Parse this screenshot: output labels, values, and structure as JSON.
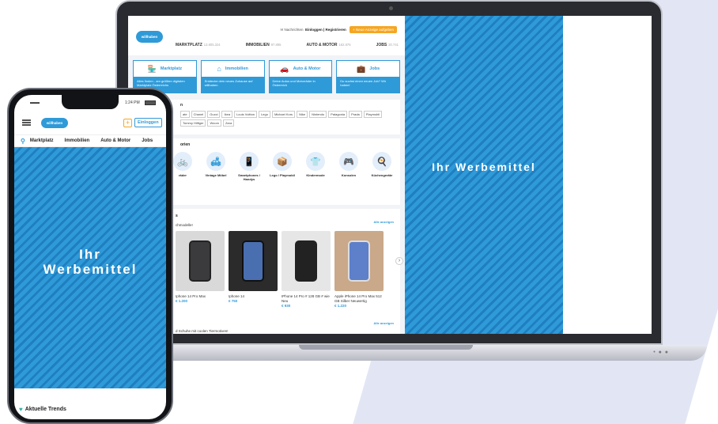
{
  "desktop": {
    "top_links": {
      "messages": "Nachrichten",
      "login": "Einloggen | Registrieren",
      "new_ad": "+ Neue Anzeige aufgeben"
    },
    "nav": [
      {
        "label": "MARKTPLATZ",
        "count": "13.805.324"
      },
      {
        "label": "IMMOBILIEN",
        "count": "97.895"
      },
      {
        "label": "AUTO & MOTOR",
        "count": "182.876"
      },
      {
        "label": "JOBS",
        "count": "20.741"
      }
    ],
    "cards": [
      {
        "icon": "storefront-icon",
        "glyph": "🏪",
        "title": "Marktplatz",
        "desc": "Alles finden - am größten digitalen Marktplatz Österreichs"
      },
      {
        "icon": "house-icon",
        "glyph": "⌂",
        "title": "Immobilien",
        "desc": "Entdecke dein neues Zuhause auf willhaben"
      },
      {
        "icon": "car-icon",
        "glyph": "🚗",
        "title": "Auto & Motor",
        "desc": "Deine Autos und Motorräder in Österreich"
      },
      {
        "icon": "briefcase-icon",
        "glyph": "💼",
        "title": "Jobs",
        "desc": "Du suchst einen neuen Job? Wir haben!"
      }
    ],
    "brands_title": "n",
    "brands": [
      "ate",
      "Chanel",
      "Gucci",
      "Ikea",
      "Louis Vuitton",
      "Lego",
      "Michael Kors",
      "Nike",
      "Nintendo",
      "Patagonia",
      "Prada",
      "Playmobil",
      "Tommy Hilfiger",
      "Woom",
      "Zara"
    ],
    "categories_title": "orien",
    "categories": [
      {
        "icon": "bicycle-icon",
        "glyph": "🚲",
        "label": "räder"
      },
      {
        "icon": "sofa-icon",
        "glyph": "🛋",
        "label": "Vintage Möbel"
      },
      {
        "icon": "smartphone-icon",
        "glyph": "📱",
        "label": "Smartphones / Handys"
      },
      {
        "icon": "toy-box-icon",
        "glyph": "📦",
        "label": "Lego / Playmobil"
      },
      {
        "icon": "kids-clothing-icon",
        "glyph": "👕",
        "label": "Kindermode"
      },
      {
        "icon": "gamepad-icon",
        "glyph": "🎮",
        "label": "Konsolen"
      },
      {
        "icon": "kitchen-appliance-icon",
        "glyph": "🍳",
        "label": "Küchengeräte"
      }
    ],
    "trends_title": "s",
    "trends_subtitle": "chmodelle!",
    "see_all": "Alle anzeigen",
    "products": [
      {
        "name": "Iphone 14 Pro Max",
        "price": "€ 1.200"
      },
      {
        "name": "Iphone 14",
        "price": "€ 750"
      },
      {
        "name": "IPhone 14 Pro # 128 GB # wie Neu",
        "price": "€ 930"
      },
      {
        "name": "Apple iPhone 14 Pro Max 512 GB Silber Neuwertig",
        "price": "€ 1.220"
      }
    ],
    "second_subtitle": "d Schuhe mit coolen Tiermotiven!",
    "see_all_2": "Alle anzeigen",
    "ad_text": "Ihr Werbemittel"
  },
  "mobile": {
    "time": "1:24 PM",
    "login": "Einloggen",
    "nav": [
      "Marktplatz",
      "Immobilien",
      "Auto & Motor",
      "Jobs"
    ],
    "ad_text": "Ihr Werbemittel",
    "trends_title": "Aktuelle Trends"
  },
  "logo_text": "willhaben",
  "colors": {
    "brand_blue": "#2f9ad8",
    "accent_orange": "#f5a623",
    "background_shape": "#e2e6f4"
  }
}
